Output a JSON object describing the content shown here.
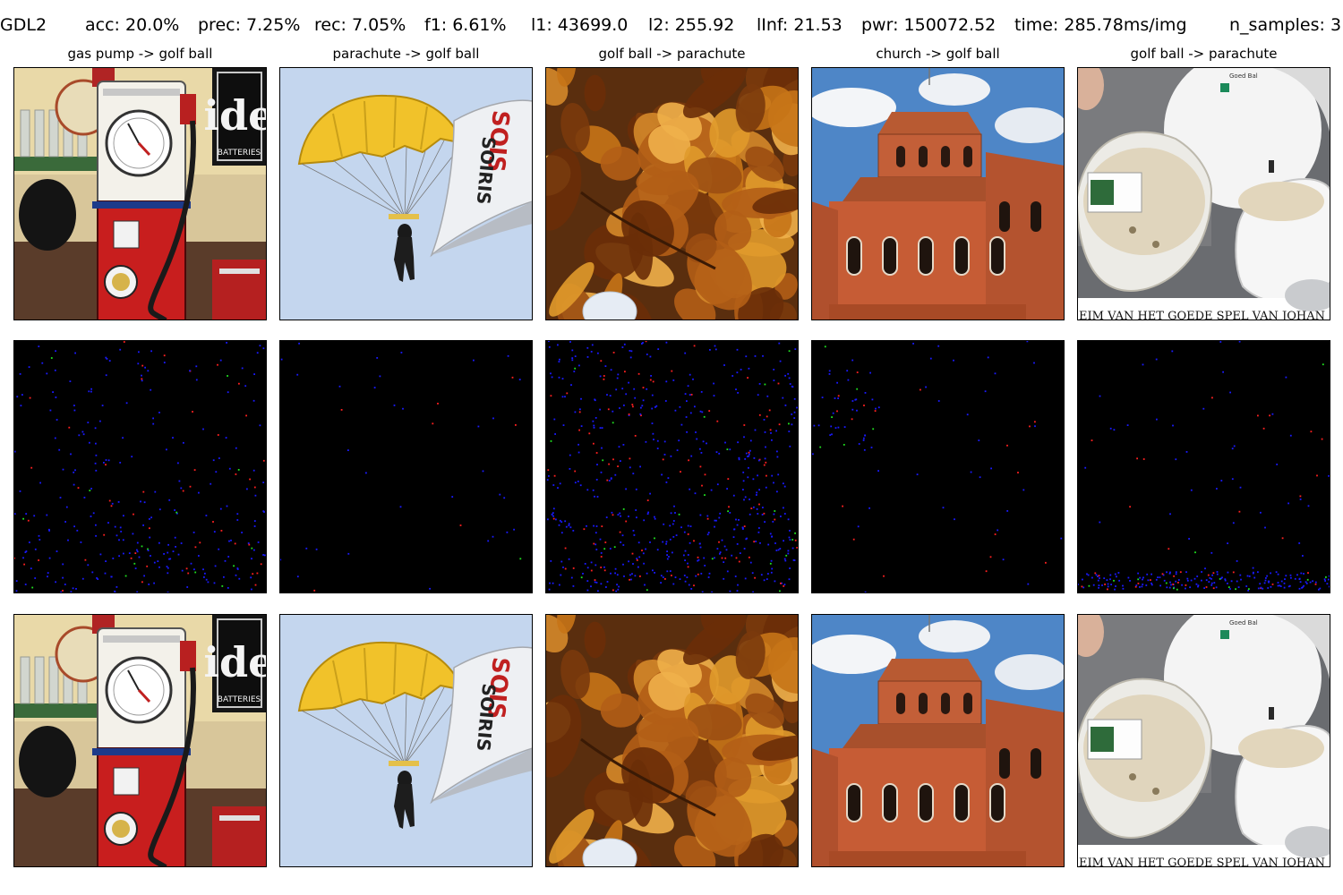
{
  "header": {
    "metrics": [
      "GDL2",
      "acc: 20.0%",
      "prec: 7.25%",
      "rec: 7.05%",
      "f1: 6.61%",
      "l1: 43699.0",
      "l2: 255.92",
      "lInf: 21.53",
      "pwr: 150072.52",
      "time: 285.78ms/img",
      "n_samples: 3"
    ]
  },
  "columns": [
    {
      "title": "gas pump -> golf ball",
      "scene": "gas-pump"
    },
    {
      "title": "parachute -> golf ball",
      "scene": "parachute"
    },
    {
      "title": "golf ball -> parachute",
      "scene": "autumn-leaves"
    },
    {
      "title": "church -> golf ball",
      "scene": "church"
    },
    {
      "title": "golf ball -> parachute",
      "scene": "golf-balls"
    }
  ],
  "rows": [
    "original-image",
    "perturbation-map",
    "adversarial-image"
  ],
  "colors": {
    "background": "#ffffff",
    "panel_border": "#000000",
    "perturbation_background": "#000000",
    "perturbation_dot_blue": "#1a1aff",
    "perturbation_dot_red": "#ff2020",
    "perturbation_dot_green": "#20e020"
  }
}
